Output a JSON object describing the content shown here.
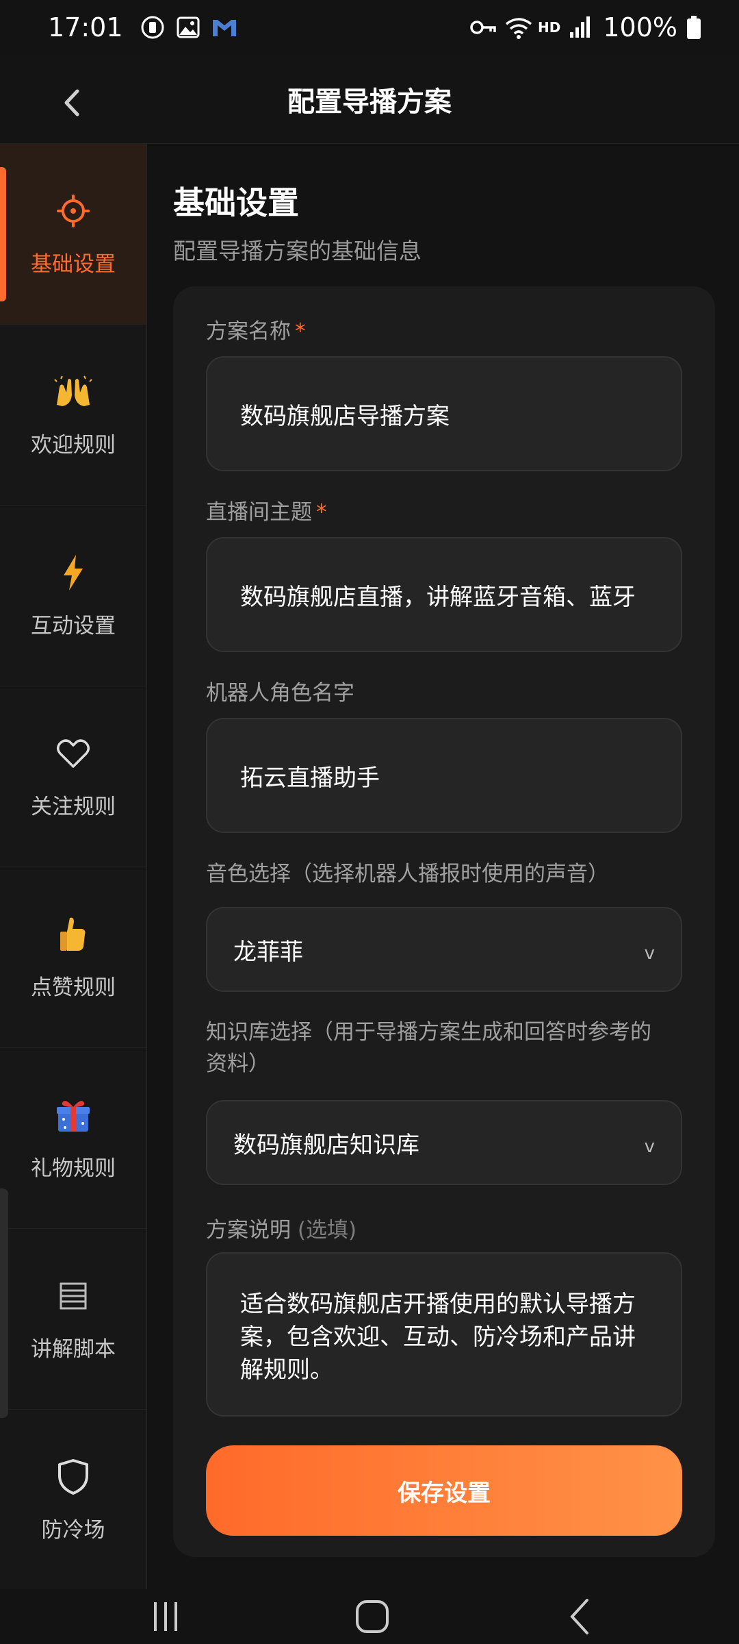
{
  "status_bar": {
    "time": "17:01",
    "battery": "100%",
    "network_label": "HD",
    "left_icons": [
      "timer-icon",
      "gallery-icon",
      "gmail-icon"
    ],
    "right_icons": [
      "vpn-key-icon",
      "wifi-icon",
      "signal-icon",
      "battery-icon"
    ]
  },
  "header": {
    "title": "配置导播方案"
  },
  "sidebar": {
    "active_index": 0,
    "items": [
      {
        "label": "基础设置",
        "icon": "gear-icon"
      },
      {
        "label": "欢迎规则",
        "icon": "raised-hands-icon"
      },
      {
        "label": "互动设置",
        "icon": "lightning-icon"
      },
      {
        "label": "关注规则",
        "icon": "heart-icon"
      },
      {
        "label": "点赞规则",
        "icon": "thumbs-up-icon"
      },
      {
        "label": "礼物规则",
        "icon": "gift-icon"
      },
      {
        "label": "讲解脚本",
        "icon": "list-icon"
      },
      {
        "label": "防冷场",
        "icon": "shield-icon"
      }
    ]
  },
  "section": {
    "title": "基础设置",
    "subtitle": "配置导播方案的基础信息"
  },
  "form": {
    "plan_name": {
      "label": "方案名称",
      "required_mark": "*",
      "value": "数码旗舰店导播方案"
    },
    "live_topic": {
      "label": "直播间主题",
      "required_mark": "*",
      "value": "数码旗舰店直播，讲解蓝牙音箱、蓝牙"
    },
    "robot_name": {
      "label": "机器人角色名字",
      "value": "拓云直播助手"
    },
    "voice": {
      "label": "音色选择（选择机器人播报时使用的声音）",
      "value": "龙菲菲",
      "chevron": "v"
    },
    "knowledge": {
      "label_line1": "知识库选择（用于导播方案生成和回答时参考的",
      "label_line2": "资料）",
      "value": "数码旗舰店知识库",
      "chevron": "v"
    },
    "description": {
      "label": "方案说明",
      "optional": "(选填)",
      "value": "适合数码旗舰店开播使用的默认导播方案，包含欢迎、互动、防冷场和产品讲解规则。"
    },
    "save_label": "保存设置"
  },
  "colors": {
    "accent": "#ff6b2c",
    "background": "#131313",
    "card": "#1c1c1c",
    "input": "#252525"
  }
}
